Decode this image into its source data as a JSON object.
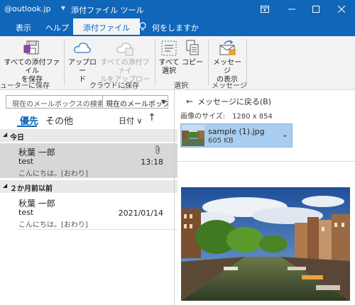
{
  "window": {
    "account": "@outlook.jp",
    "context_title": "添付ファイル ツール",
    "separator": "▾"
  },
  "tabs": [
    {
      "label": "表示",
      "active": false
    },
    {
      "label": "ヘルプ",
      "active": false
    },
    {
      "label": "添付ファイル",
      "active": true
    },
    {
      "label": "何をしますか",
      "active": false
    }
  ],
  "ribbon": {
    "save_all": "すべての添付ファイル\nを保存",
    "upload": "アップロー\nド",
    "upload_all": "すべての添付ファイ\nルをアップロード",
    "select_all": "すべて\n選択",
    "copy": "コピー",
    "show_message": "メッセージ\nの表示",
    "groups": {
      "save": "ューターに保存",
      "cloud": "クラウドに保存",
      "select": "選択",
      "message": "メッセージ"
    }
  },
  "mailbox": {
    "search_placeholder": "現在のメールボックスの検索",
    "scope": "現在のメールボックス",
    "tab_focused": "優先",
    "tab_other": "その他",
    "sort_by": "日付 ∨",
    "sort_dir": "↑"
  },
  "groups": [
    {
      "label": "今日"
    },
    {
      "label": "２か月前以前"
    }
  ],
  "messages": [
    {
      "from": "秋葉 一郎",
      "subject": "test",
      "preview": "こんにちは。[おわり]",
      "time": "13:18",
      "has_attachment": true,
      "selected": true
    },
    {
      "from": "秋葉 一郎",
      "subject": "test",
      "preview": "こんにちは。[おわり]",
      "time": "2021/01/14",
      "has_attachment": false,
      "selected": false
    }
  ],
  "reading": {
    "back_label": "メッセージに戻る(B)",
    "image_size": "画像のサイズ:　1280 x 854",
    "attachment_name": "sample (1).jpg",
    "attachment_size": "605 KB"
  },
  "colors": {
    "accent": "#1066b8",
    "selected_row": "#d7d7d7",
    "attachment_highlight": "#a8cdee"
  }
}
